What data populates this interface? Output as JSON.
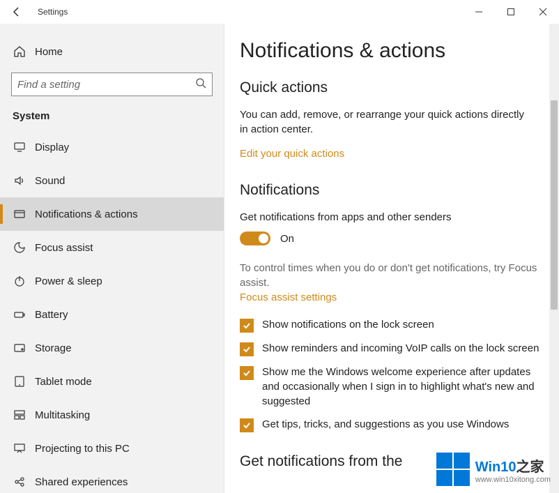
{
  "window": {
    "title": "Settings"
  },
  "sidebar": {
    "home_label": "Home",
    "search_placeholder": "Find a setting",
    "category": "System",
    "items": [
      {
        "label": "Display",
        "icon": "display"
      },
      {
        "label": "Sound",
        "icon": "sound"
      },
      {
        "label": "Notifications & actions",
        "icon": "notifications",
        "active": true
      },
      {
        "label": "Focus assist",
        "icon": "focus"
      },
      {
        "label": "Power & sleep",
        "icon": "power"
      },
      {
        "label": "Battery",
        "icon": "battery"
      },
      {
        "label": "Storage",
        "icon": "storage"
      },
      {
        "label": "Tablet mode",
        "icon": "tablet"
      },
      {
        "label": "Multitasking",
        "icon": "multitasking"
      },
      {
        "label": "Projecting to this PC",
        "icon": "projecting"
      },
      {
        "label": "Shared experiences",
        "icon": "shared"
      }
    ]
  },
  "main": {
    "page_title": "Notifications & actions",
    "quick_actions": {
      "heading": "Quick actions",
      "description": "You can add, remove, or rearrange your quick actions directly in action center.",
      "link": "Edit your quick actions"
    },
    "notifications": {
      "heading": "Notifications",
      "toggle_label": "Get notifications from apps and other senders",
      "toggle_state": "On",
      "focus_hint": "To control times when you do or don't get notifications, try Focus assist.",
      "focus_link": "Focus assist settings",
      "checkboxes": [
        {
          "label": "Show notifications on the lock screen",
          "checked": true
        },
        {
          "label": "Show reminders and incoming VoIP calls on the lock screen",
          "checked": true
        },
        {
          "label": "Show me the Windows welcome experience after updates and occasionally when I sign in to highlight what's new and suggested",
          "checked": true
        },
        {
          "label": "Get tips, tricks, and suggestions as you use Windows",
          "checked": true
        }
      ]
    },
    "next_section_heading": "Get notifications from the"
  },
  "watermark": {
    "line1_a": "Win10",
    "line1_b": "之家",
    "line2": "www.win10xitong.com"
  }
}
